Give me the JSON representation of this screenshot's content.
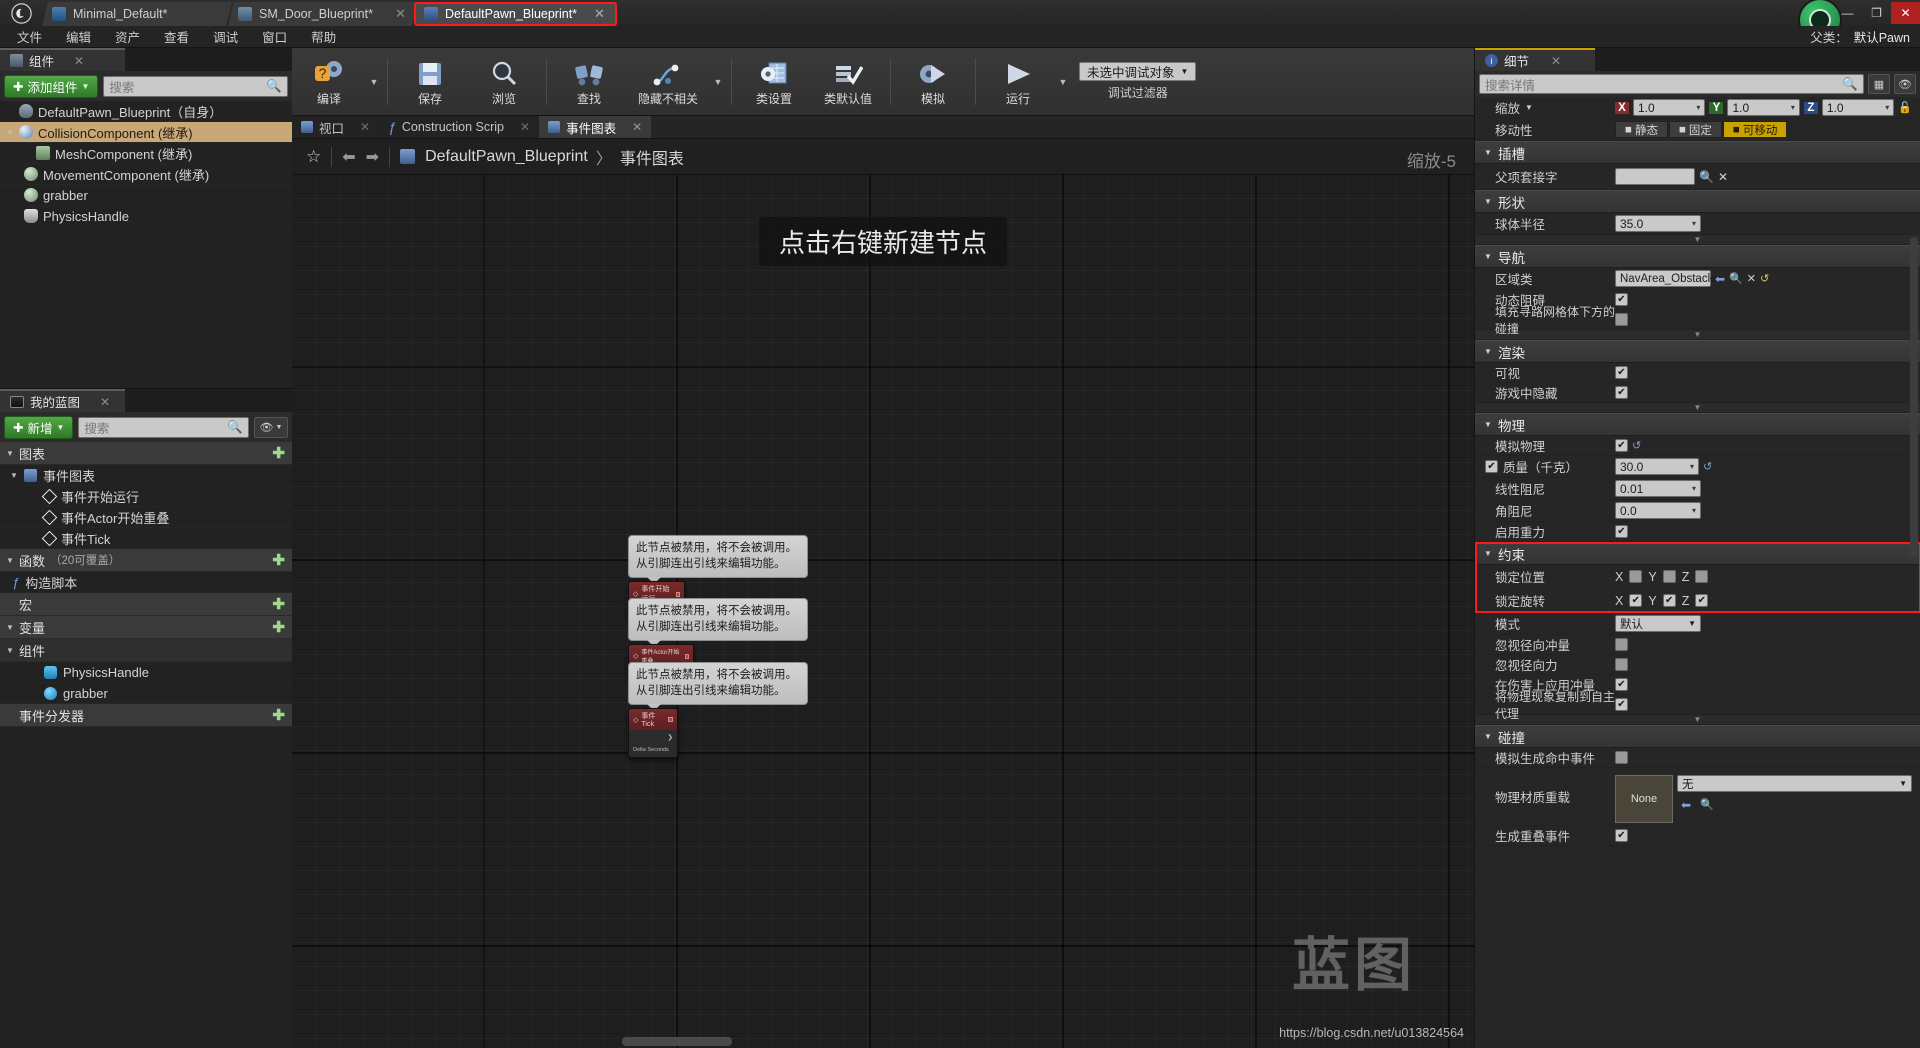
{
  "window": {
    "tabs": [
      {
        "label": "Minimal_Default*",
        "icon": "level-icon",
        "active": false,
        "highlight": false
      },
      {
        "label": "SM_Door_Blueprint*",
        "icon": "blueprint-house-icon",
        "active": false,
        "highlight": false
      },
      {
        "label": "DefaultPawn_Blueprint*",
        "icon": "pawn-icon",
        "active": true,
        "highlight": true
      }
    ],
    "controls": {
      "minimize": "—",
      "maximize": "❐",
      "close": "✕"
    },
    "parent_class_label": "父类：",
    "parent_class_value": "默认Pawn"
  },
  "menubar": [
    "文件",
    "编辑",
    "资产",
    "查看",
    "调试",
    "窗口",
    "帮助"
  ],
  "components_panel": {
    "tab_label": "组件",
    "add_button": "添加组件",
    "search_placeholder": "搜索",
    "items": [
      {
        "label": "DefaultPawn_Blueprint（自身）",
        "indent": 0,
        "icon": "pawn-icon",
        "selected": false,
        "expander": ""
      },
      {
        "label": "CollisionComponent (继承)",
        "indent": 1,
        "icon": "sphere-icon",
        "selected": true,
        "expander": "▾"
      },
      {
        "label": "MeshComponent (继承)",
        "indent": 2,
        "icon": "mesh-icon",
        "selected": false,
        "expander": ""
      },
      {
        "label": "MovementComponent (继承)",
        "indent": 1,
        "icon": "movement-icon",
        "selected": false,
        "expander": ""
      },
      {
        "label": "grabber",
        "indent": 1,
        "icon": "movement-icon",
        "selected": false,
        "expander": ""
      },
      {
        "label": "PhysicsHandle",
        "indent": 1,
        "icon": "physics-handle-icon",
        "selected": false,
        "expander": ""
      }
    ]
  },
  "myblueprint_panel": {
    "tab_label": "我的蓝图",
    "add_button": "新增",
    "search_placeholder": "搜索",
    "sections": [
      {
        "label": "图表",
        "type": "header",
        "has_add": true
      },
      {
        "label": "事件图表",
        "type": "graph",
        "has_add": false
      },
      {
        "label": "事件开始运行",
        "type": "event",
        "has_add": false
      },
      {
        "label": "事件Actor开始重叠",
        "type": "event",
        "has_add": false
      },
      {
        "label": "事件Tick",
        "type": "event",
        "has_add": false
      },
      {
        "label": "函数",
        "sub": "（20可覆盖）",
        "type": "header",
        "has_add": true
      },
      {
        "label": "构造脚本",
        "type": "function",
        "has_add": false
      },
      {
        "label": "宏",
        "type": "header",
        "has_add": true
      },
      {
        "label": "变量",
        "type": "header",
        "has_add": true
      },
      {
        "label": "组件",
        "type": "subheader",
        "has_add": false
      },
      {
        "label": "PhysicsHandle",
        "type": "variable",
        "has_add": false
      },
      {
        "label": "grabber",
        "type": "variable",
        "has_add": false
      },
      {
        "label": "事件分发器",
        "type": "header",
        "has_add": true
      }
    ]
  },
  "toolbar": {
    "items": [
      {
        "label": "编译",
        "icon": "compile-icon",
        "carat": true
      },
      {
        "label": "保存",
        "icon": "save-icon",
        "carat": false
      },
      {
        "label": "浏览",
        "icon": "browse-icon",
        "carat": false
      },
      {
        "label": "查找",
        "icon": "find-icon",
        "carat": false
      },
      {
        "label": "隐藏不相关",
        "icon": "hide-unrelated-icon",
        "carat": true
      },
      {
        "label": "类设置",
        "icon": "class-settings-icon",
        "carat": false
      },
      {
        "label": "类默认值",
        "icon": "class-defaults-icon",
        "carat": false
      },
      {
        "label": "模拟",
        "icon": "simulate-icon",
        "carat": false
      },
      {
        "label": "运行",
        "icon": "play-icon",
        "carat": true
      }
    ],
    "debug_object": "未选中调试对象",
    "debug_filter_label": "调试过滤器"
  },
  "graph": {
    "tabs": [
      {
        "label": "视口",
        "icon": "viewport-icon",
        "active": false
      },
      {
        "label": "Construction Scrip",
        "icon": "function-icon",
        "active": false
      },
      {
        "label": "事件图表",
        "icon": "graph-icon",
        "active": true
      }
    ],
    "breadcrumb": {
      "root": "DefaultPawn_Blueprint",
      "sep": "〉",
      "leaf": "事件图表"
    },
    "zoom_label": "缩放-5",
    "hint": "点击右键新建节点",
    "watermark": "蓝图",
    "url_watermark": "https://blog.csdn.net/u013824564",
    "tooltips": [
      {
        "line1": "此节点被禁用，将不会被调用。",
        "line2": "从引脚连出引线来编辑功能。"
      },
      {
        "line1": "此节点被禁用，将不会被调用。",
        "line2": "从引脚连出引线来编辑功能。"
      },
      {
        "line1": "此节点被禁用，将不会被调用。",
        "line2": "从引脚连出引线来编辑功能。"
      }
    ],
    "nodes": [
      {
        "title": "事件开始运行",
        "body": ""
      },
      {
        "title": "事件Actor开始重叠",
        "body": ""
      },
      {
        "title": "事件Tick",
        "body": "Delta Seconds"
      }
    ]
  },
  "details": {
    "tab_label": "细节",
    "search_placeholder": "搜索详情",
    "transform": {
      "scale_label": "缩放",
      "axes": [
        {
          "tag": "X",
          "value": "1.0"
        },
        {
          "tag": "Y",
          "value": "1.0"
        },
        {
          "tag": "Z",
          "value": "1.0"
        }
      ],
      "mobility_label": "移动性",
      "mobility_options": [
        "静态",
        "固定",
        "可移动"
      ],
      "mobility_selected": "可移动"
    },
    "groups": [
      {
        "name": "插槽",
        "rows": [
          {
            "label": "父项套接字",
            "type": "socket",
            "value": ""
          }
        ]
      },
      {
        "name": "形状",
        "rows": [
          {
            "label": "球体半径",
            "type": "text",
            "value": "35.0"
          }
        ]
      },
      {
        "name": "导航",
        "rows": [
          {
            "label": "区域类",
            "type": "combo-nav",
            "value": "NavArea_Obstacle"
          },
          {
            "label": "动态阻碍",
            "type": "check",
            "value": true
          },
          {
            "label": "填充寻路网格体下方的碰撞",
            "type": "check",
            "value": false
          }
        ]
      },
      {
        "name": "渲染",
        "rows": [
          {
            "label": "可视",
            "type": "check",
            "value": true
          },
          {
            "label": "游戏中隐藏",
            "type": "check",
            "value": true
          }
        ]
      },
      {
        "name": "物理",
        "rows": [
          {
            "label": "模拟物理",
            "type": "check-reset",
            "value": true
          },
          {
            "label": "质量（千克）",
            "type": "check-text-reset",
            "checked": true,
            "value": "30.0"
          },
          {
            "label": "线性阻尼",
            "type": "text",
            "value": "0.01"
          },
          {
            "label": "角阻尼",
            "type": "text",
            "value": "0.0"
          },
          {
            "label": "启用重力",
            "type": "check",
            "value": true
          }
        ]
      },
      {
        "name": "约束",
        "highlighted": true,
        "rows": [
          {
            "label": "锁定位置",
            "type": "xyz-check",
            "x": false,
            "y": false,
            "z": false
          },
          {
            "label": "锁定旋转",
            "type": "xyz-check",
            "x": true,
            "y": true,
            "z": true
          },
          {
            "label": "模式",
            "type": "combo",
            "value": "默认"
          }
        ]
      },
      {
        "name": "",
        "rows": [
          {
            "label": "忽视径向冲量",
            "type": "check",
            "value": false
          },
          {
            "label": "忽视径向力",
            "type": "check",
            "value": false
          },
          {
            "label": "在伤害上应用冲量",
            "type": "check",
            "value": true
          },
          {
            "label": "将物理现象复制到自主代理",
            "type": "check",
            "value": true
          }
        ]
      },
      {
        "name": "碰撞",
        "rows": [
          {
            "label": "模拟生成命中事件",
            "type": "check",
            "value": false
          },
          {
            "label": "物理材质重载",
            "type": "material",
            "thumb": "None",
            "value": "无"
          },
          {
            "label": "生成重叠事件",
            "type": "check",
            "value": true
          }
        ]
      }
    ]
  }
}
